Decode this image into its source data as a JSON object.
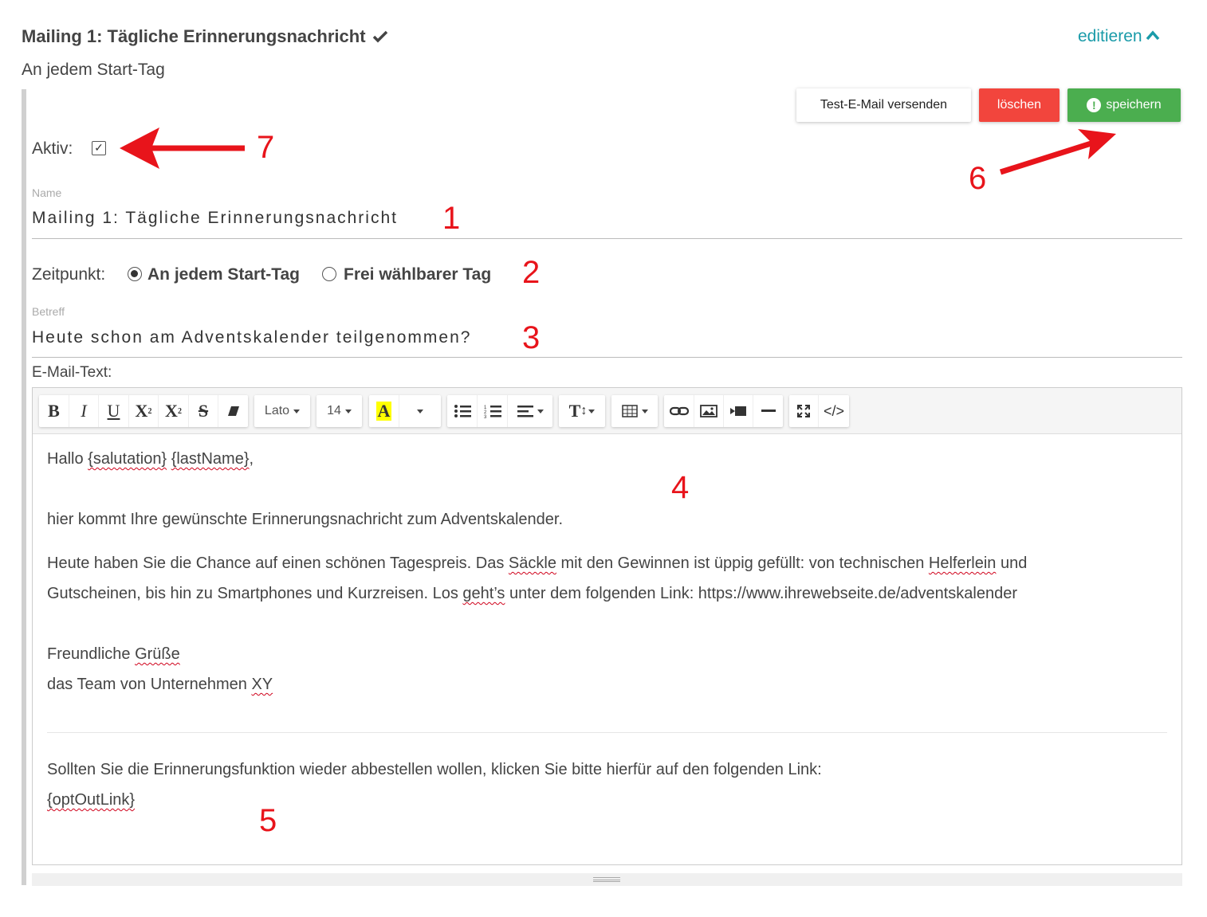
{
  "header": {
    "title": "Mailing 1: Tägliche Erinnerungsnachricht",
    "subtitle": "An jedem Start-Tag",
    "edit_label": "editieren"
  },
  "actions": {
    "test_label": "Test-E-Mail versenden",
    "delete_label": "löschen",
    "save_label": "speichern"
  },
  "form": {
    "aktiv_label": "Aktiv:",
    "aktiv_checked": true,
    "name_label": "Name",
    "name_value": "Mailing 1: Tägliche Erinnerungsnachricht",
    "zeitpunkt_label": "Zeitpunkt:",
    "zeitpunkt_options": [
      {
        "label": "An jedem Start-Tag",
        "selected": true
      },
      {
        "label": "Frei wählbarer Tag",
        "selected": false
      }
    ],
    "betreff_label": "Betreff",
    "betreff_value": "Heute schon am Adventskalender teilgenommen?",
    "mail_text_label": "E-Mail-Text:"
  },
  "toolbar": {
    "font_family": "Lato",
    "font_size": "14"
  },
  "body": {
    "greeting_prefix": "Hallo ",
    "salutation_var": "{salutation}",
    "space": " ",
    "lastname_var": "{lastName}",
    "greeting_suffix": ",",
    "para1": "hier kommt Ihre gewünschte Erinnerungsnachricht zum Adventskalender.",
    "para2_a": "Heute haben Sie die Chance auf einen schönen Tagespreis. Das ",
    "para2_b": "Säckle",
    "para2_c": " mit den Gewinnen ist üppig gefüllt: von technischen ",
    "para2_d": "Helferlein",
    "para2_e": " und",
    "para2_f": "Gutscheinen, bis hin zu Smartphones und Kurzreisen. Los ",
    "para2_g": "geht’s",
    "para2_h": " unter dem folgenden Link: https://www.ihrewebseite.de/adventskalender",
    "closing_a": "Freundliche ",
    "closing_b": "Grüße",
    "team_a": "das Team von Unternehmen ",
    "team_b": "XY",
    "optout_text": "Sollten Sie die Erinnerungsfunktion wieder abbestellen wollen, klicken Sie bitte hierfür auf den folgenden Link:",
    "optout_var": "{optOutLink}"
  },
  "annotations": [
    "1",
    "2",
    "3",
    "4",
    "5",
    "6",
    "7"
  ],
  "colors": {
    "accent": "#1a9ba9",
    "delete": "#f2453d",
    "save": "#4bae4f",
    "annotation": "#e8141b"
  }
}
